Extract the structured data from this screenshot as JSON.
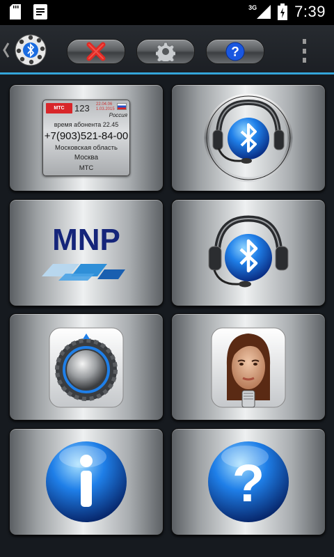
{
  "status_bar": {
    "time": "7:39",
    "network": "3G",
    "icons": [
      "sd-card-icon",
      "notification-icon",
      "signal-icon",
      "battery-charging-icon"
    ]
  },
  "action_bar": {
    "app_icon": "bluetooth-phone-dial-icon",
    "buttons": [
      {
        "name": "close",
        "icon": "close-x-icon",
        "color": "#e02a24"
      },
      {
        "name": "settings",
        "icon": "gear-icon",
        "color": "#c9cccf"
      },
      {
        "name": "help",
        "icon": "help-question-icon",
        "color": "#1a57e0"
      }
    ],
    "overflow_icon": "overflow-menu-icon",
    "accent": "#33a5d9"
  },
  "caller_card": {
    "operator_logo": "МТС",
    "code": "123",
    "date_updated": "22.04.06",
    "date_base": "1.03.2015",
    "region": "Россия",
    "time_label": "время абонента 22.45",
    "phone": "+7(903)521-84-00",
    "location": "Московская область",
    "city": "Москва",
    "operator": "МТС"
  },
  "tiles": [
    {
      "name": "caller-id",
      "icon": "caller-card"
    },
    {
      "name": "bluetooth-headset-ring",
      "icon": "bluetooth-headset-icon"
    },
    {
      "name": "mnp",
      "icon": "mnp-logo-icon",
      "label": "MNP"
    },
    {
      "name": "bluetooth-headset",
      "icon": "bluetooth-headset-icon"
    },
    {
      "name": "volume-knob",
      "icon": "knob-icon"
    },
    {
      "name": "voice-assistant",
      "icon": "woman-microphone-icon"
    },
    {
      "name": "info",
      "icon": "info-icon"
    },
    {
      "name": "help",
      "icon": "help-icon"
    }
  ]
}
